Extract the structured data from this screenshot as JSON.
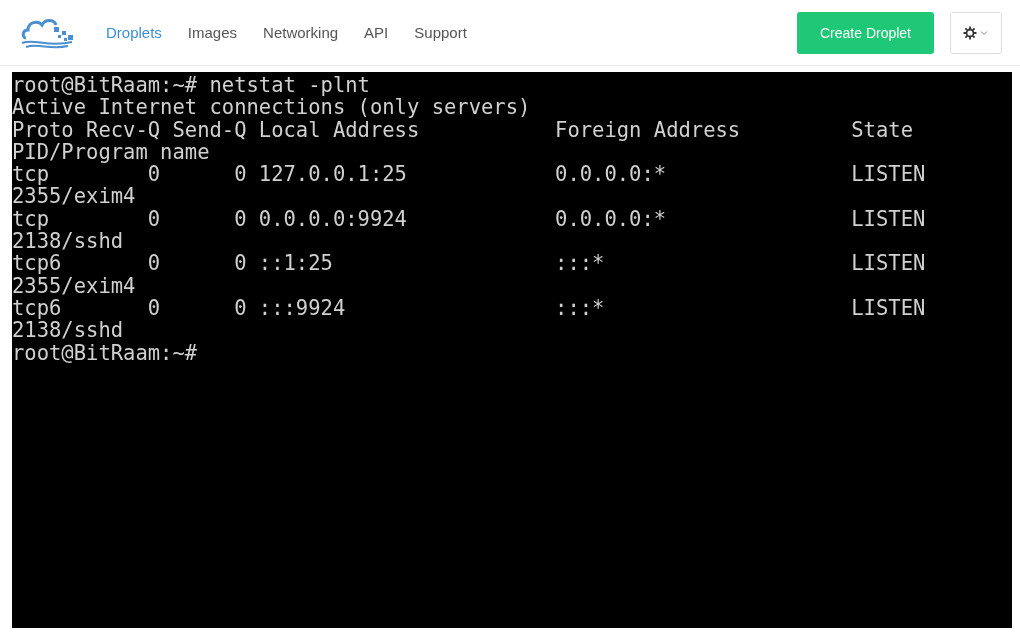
{
  "nav": {
    "tabs": [
      {
        "label": "Droplets",
        "selected": true
      },
      {
        "label": "Images",
        "selected": false
      },
      {
        "label": "Networking",
        "selected": false
      },
      {
        "label": "API",
        "selected": false
      },
      {
        "label": "Support",
        "selected": false
      }
    ],
    "create_button": "Create Droplet"
  },
  "terminal": {
    "lines": [
      "root@BitRaam:~# netstat -plnt",
      "Active Internet connections (only servers)",
      "Proto Recv-Q Send-Q Local Address           Foreign Address         State",
      "PID/Program name",
      "tcp        0      0 127.0.0.1:25            0.0.0.0:*               LISTEN",
      "2355/exim4",
      "tcp        0      0 0.0.0.0:9924            0.0.0.0:*               LISTEN",
      "2138/sshd",
      "tcp6       0      0 ::1:25                  :::*                    LISTEN",
      "2355/exim4",
      "tcp6       0      0 :::9924                 :::*                    LISTEN",
      "2138/sshd",
      "root@BitRaam:~#"
    ]
  }
}
